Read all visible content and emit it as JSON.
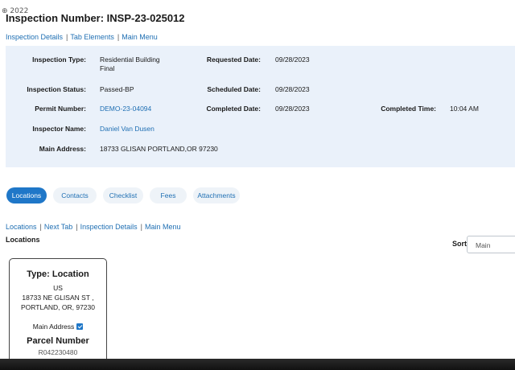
{
  "page": {
    "corner_glyph": "⊕ 2022",
    "title": "Inspection Number: INSP-23-025012"
  },
  "top_links": [
    "Inspection Details",
    "Tab Elements",
    "Main Menu"
  ],
  "details": {
    "inspection_type_label": "Inspection Type:",
    "inspection_type_line1": "Residential Building",
    "inspection_type_line2": "Final",
    "requested_date_label": "Requested Date:",
    "requested_date": "09/28/2023",
    "inspection_status_label": "Inspection Status:",
    "inspection_status": "Passed-BP",
    "scheduled_date_label": "Scheduled Date:",
    "scheduled_date": "09/28/2023",
    "permit_number_label": "Permit Number:",
    "permit_number": "DEMO-23-04094",
    "completed_date_label": "Completed Date:",
    "completed_date": "09/28/2023",
    "completed_time_label": "Completed Time:",
    "completed_time": "10:04 AM",
    "inspector_name_label": "Inspector Name:",
    "inspector_name": "Daniel Van Dusen",
    "main_address_label": "Main Address:",
    "main_address": "18733 GLISAN PORTLAND,OR 97230"
  },
  "tabs": [
    {
      "label": "Locations",
      "active": true
    },
    {
      "label": "Contacts",
      "active": false
    },
    {
      "label": "Checklist",
      "active": false
    },
    {
      "label": "Fees",
      "active": false
    },
    {
      "label": "Attachments",
      "active": false
    }
  ],
  "section_links": [
    "Locations",
    "Next Tab",
    "Inspection Details",
    "Main Menu"
  ],
  "section_title": "Locations",
  "sort": {
    "label": "Sort",
    "value": "Main"
  },
  "location_card": {
    "title": "Type: Location",
    "country": "US",
    "street": "18733 NE GLISAN ST ,",
    "city": "PORTLAND, OR, 97230",
    "main_address_label": "Main Address",
    "main_address_checked": true,
    "parcel_label": "Parcel Number",
    "parcel_number": "R042230480"
  },
  "colors": {
    "accent": "#1f77c8",
    "link": "#1f6fb3",
    "panel": "#eaf1fa"
  }
}
